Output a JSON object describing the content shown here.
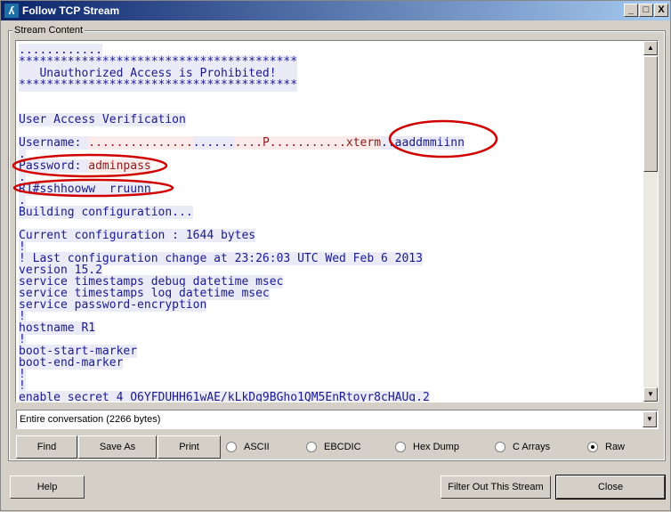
{
  "window": {
    "title": "Follow TCP Stream",
    "minimize": "_",
    "maximize": "□",
    "close": "X"
  },
  "group_label": "Stream Content",
  "colors": {
    "client_text": "#8c1a1a",
    "client_bg": "#fbeaea",
    "server_text": "#1a1a8c",
    "server_bg": "#ebebf8",
    "annotation": "#d00000"
  },
  "stream_lines": [
    [
      {
        "t": "............",
        "s": "s"
      }
    ],
    [
      {
        "t": "****************************************",
        "s": "s"
      }
    ],
    [
      {
        "t": "   Unauthorized Access is Prohibited!   ",
        "s": "s"
      }
    ],
    [
      {
        "t": "****************************************",
        "s": "s"
      }
    ],
    [],
    [],
    [
      {
        "t": "User Access Verification",
        "s": "s"
      }
    ],
    [],
    [
      {
        "t": "Username: ",
        "s": "s"
      },
      {
        "t": "...............",
        "s": "c"
      },
      {
        "t": "......",
        "s": "s"
      },
      {
        "t": "....P...........xterm",
        "s": "c"
      },
      {
        "t": "..aaddmmiinn",
        "s": "s"
      }
    ],
    [
      {
        "t": ".",
        "s": "s"
      }
    ],
    [
      {
        "t": "Password: ",
        "s": "s"
      },
      {
        "t": "adminpass",
        "s": "c"
      }
    ],
    [
      {
        "t": ".",
        "s": "s"
      }
    ],
    [
      {
        "t": "R1#sshhooww  rruunn",
        "s": "s"
      }
    ],
    [
      {
        "t": ".",
        "s": "s"
      }
    ],
    [
      {
        "t": "Building configuration...",
        "s": "s"
      }
    ],
    [],
    [
      {
        "t": "Current configuration : 1644 bytes",
        "s": "s"
      }
    ],
    [
      {
        "t": "!",
        "s": "s"
      }
    ],
    [
      {
        "t": "! Last configuration change at 23:26:03 UTC Wed Feb 6 2013",
        "s": "s"
      }
    ],
    [
      {
        "t": "version 15.2",
        "s": "s"
      }
    ],
    [
      {
        "t": "service timestamps debug datetime msec",
        "s": "s"
      }
    ],
    [
      {
        "t": "service timestamps log datetime msec",
        "s": "s"
      }
    ],
    [
      {
        "t": "service password-encryption",
        "s": "s"
      }
    ],
    [
      {
        "t": "!",
        "s": "s"
      }
    ],
    [
      {
        "t": "hostname R1",
        "s": "s"
      }
    ],
    [
      {
        "t": "!",
        "s": "s"
      }
    ],
    [
      {
        "t": "boot-start-marker",
        "s": "s"
      }
    ],
    [
      {
        "t": "boot-end-marker",
        "s": "s"
      }
    ],
    [
      {
        "t": "!",
        "s": "s"
      }
    ],
    [
      {
        "t": "!",
        "s": "s"
      }
    ],
    [
      {
        "t": "enable secret 4 O6YFDUHH61wAE/kLkDq9BGho1QM5EnRtoyr8cHAUq.2",
        "s": "s"
      }
    ]
  ],
  "conversation_select": {
    "value": "Entire conversation (2266 bytes)"
  },
  "buttons": {
    "find": "Find",
    "save_as": "Save As",
    "print": "Print",
    "help": "Help",
    "filter_out": "Filter Out This Stream",
    "close": "Close"
  },
  "formats": [
    {
      "label": "ASCII",
      "selected": false
    },
    {
      "label": "EBCDIC",
      "selected": false
    },
    {
      "label": "Hex Dump",
      "selected": false
    },
    {
      "label": "C Arrays",
      "selected": false
    },
    {
      "label": "Raw",
      "selected": true
    }
  ]
}
